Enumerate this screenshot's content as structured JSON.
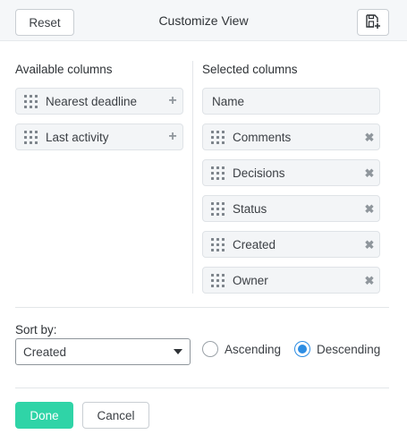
{
  "header": {
    "reset_label": "Reset",
    "title": "Customize View",
    "save_icon": "save-add-icon"
  },
  "available": {
    "heading": "Available columns",
    "items": [
      {
        "label": "Nearest deadline",
        "action_icon": "plus-icon"
      },
      {
        "label": "Last activity",
        "action_icon": "plus-icon"
      }
    ]
  },
  "selected": {
    "heading": "Selected columns",
    "fixed_item": "Name",
    "items": [
      {
        "label": "Comments",
        "action_icon": "remove-icon"
      },
      {
        "label": "Decisions",
        "action_icon": "remove-icon"
      },
      {
        "label": "Status",
        "action_icon": "remove-icon"
      },
      {
        "label": "Created",
        "action_icon": "remove-icon"
      },
      {
        "label": "Owner",
        "action_icon": "remove-icon"
      }
    ]
  },
  "sort": {
    "label": "Sort by:",
    "selected_value": "Created",
    "order_options": [
      {
        "label": "Ascending",
        "checked": false
      },
      {
        "label": "Descending",
        "checked": true
      }
    ]
  },
  "footer": {
    "done_label": "Done",
    "cancel_label": "Cancel"
  },
  "colors": {
    "accent_done": "#2fd4a7",
    "radio_selected": "#2d8de3",
    "header_bg": "#f5f7f9"
  }
}
